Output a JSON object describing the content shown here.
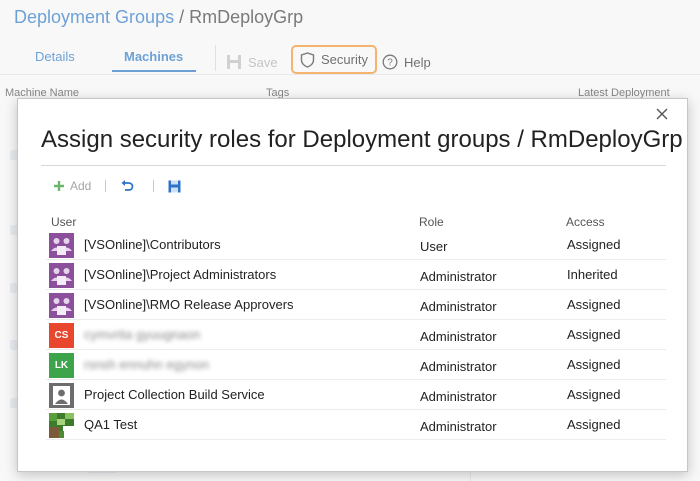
{
  "header": {
    "breadcrumb_root": "Deployment Groups",
    "breadcrumb_sep": "/",
    "breadcrumb_current": "RmDeployGrp"
  },
  "tabs": [
    {
      "label": "Details"
    },
    {
      "label": "Machines"
    }
  ],
  "toolbar": {
    "save_label": "Save",
    "security_label": "Security",
    "help_label": "Help"
  },
  "background_columns": {
    "machine_name": "Machine Name",
    "tags": "Tags",
    "latest_deployment": "Latest Deployment"
  },
  "dialog": {
    "title": "Assign security roles for Deployment groups / RmDeployGrp",
    "add_label": "Add",
    "columns": {
      "user": "User",
      "role": "Role",
      "access": "Access"
    },
    "rows": [
      {
        "name": "[VSOnline]\\Contributors",
        "role": "User",
        "access": "Assigned",
        "avatar": "group",
        "initials": ""
      },
      {
        "name": "[VSOnline]\\Project Administrators",
        "role": "Administrator",
        "access": "Inherited",
        "avatar": "group",
        "initials": ""
      },
      {
        "name": "[VSOnline]\\RMO Release Approvers",
        "role": "Administrator",
        "access": "Assigned",
        "avatar": "group",
        "initials": ""
      },
      {
        "name": "cymvrita gyuugnaon",
        "role": "Administrator",
        "access": "Assigned",
        "avatar": "initials",
        "initials": "CS",
        "color": "#e8472e"
      },
      {
        "name": "rsnsh ennuhn egynon",
        "role": "Administrator",
        "access": "Assigned",
        "avatar": "initials",
        "initials": "LK",
        "color": "#3ea44b"
      },
      {
        "name": "Project Collection Build Service",
        "role": "Administrator",
        "access": "Assigned",
        "avatar": "service",
        "initials": ""
      },
      {
        "name": "QA1 Test",
        "role": "Administrator",
        "access": "Assigned",
        "avatar": "pixel",
        "initials": ""
      }
    ]
  },
  "colors": {
    "link": "#1f6fc1",
    "security_highlight": "#f08a24",
    "group_avatar": "#8b4f9c"
  }
}
